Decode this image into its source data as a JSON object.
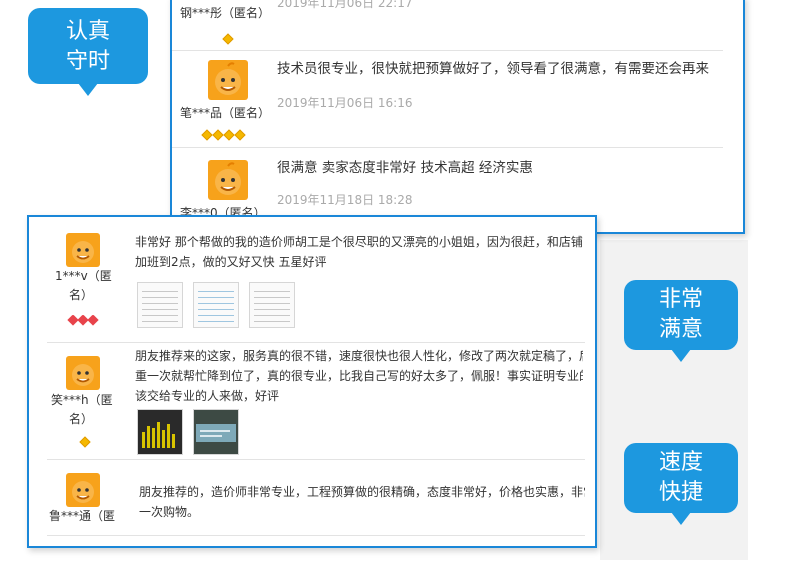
{
  "bubbles": {
    "first": [
      "认真",
      "守时"
    ],
    "second": [
      "非常",
      "满意"
    ],
    "third": [
      "速度",
      "快捷"
    ]
  },
  "top_card": {
    "reviews": [
      {
        "user": "钢***彤（匿名）",
        "date": "2019年11月06日 22:17",
        "comment": "",
        "rating": 1
      },
      {
        "user": "笔***品（匿名）",
        "date": "2019年11月06日 16:16",
        "comment": "技术员很专业，很快就把预算做好了，领导看了很满意，有需要还会再来",
        "rating": 4
      },
      {
        "user": "李***0（匿名）",
        "date": "2019年11月18日 18:28",
        "comment": "很满意 卖家态度非常好 技术高超 经济实惠",
        "rating": 0
      }
    ]
  },
  "bottom_card": {
    "reviews": [
      {
        "user_line1": "1***v（匿",
        "user_line2": "名）",
        "comment_lines": [
          "非常好 那个帮做的我的造价师胡工是个很尽职的又漂亮的小姐姐，因为很赶，和店铺",
          "加班到2点，做的又好又快 五星好评"
        ],
        "rating_icon": "heart-icon"
      },
      {
        "user_line1": "笑***h（匿",
        "user_line2": "名）",
        "comment_lines": [
          "朋友推荐来的这家，服务真的很不错，速度很快也很人性化，修改了两次就定稿了，后",
          "重一次就帮忙降到位了，真的很专业，比我自己写的好太多了，佩服！事实证明专业的",
          "该交给专业的人来做，好评"
        ],
        "rating_icon": "diamond-icon"
      },
      {
        "user_line1": "鲁***通（匿",
        "comment_lines": [
          "朋友推荐的，造价师非常专业，工程预算做的很精确，态度非常好，价格也实惠，非常",
          "一次购物。"
        ]
      }
    ]
  },
  "colors": {
    "accent": "#1a87d8",
    "bubble": "#1d98df",
    "avatar": "#f7a21b",
    "diamond": "#f5b800",
    "heart": "#e8434b"
  }
}
